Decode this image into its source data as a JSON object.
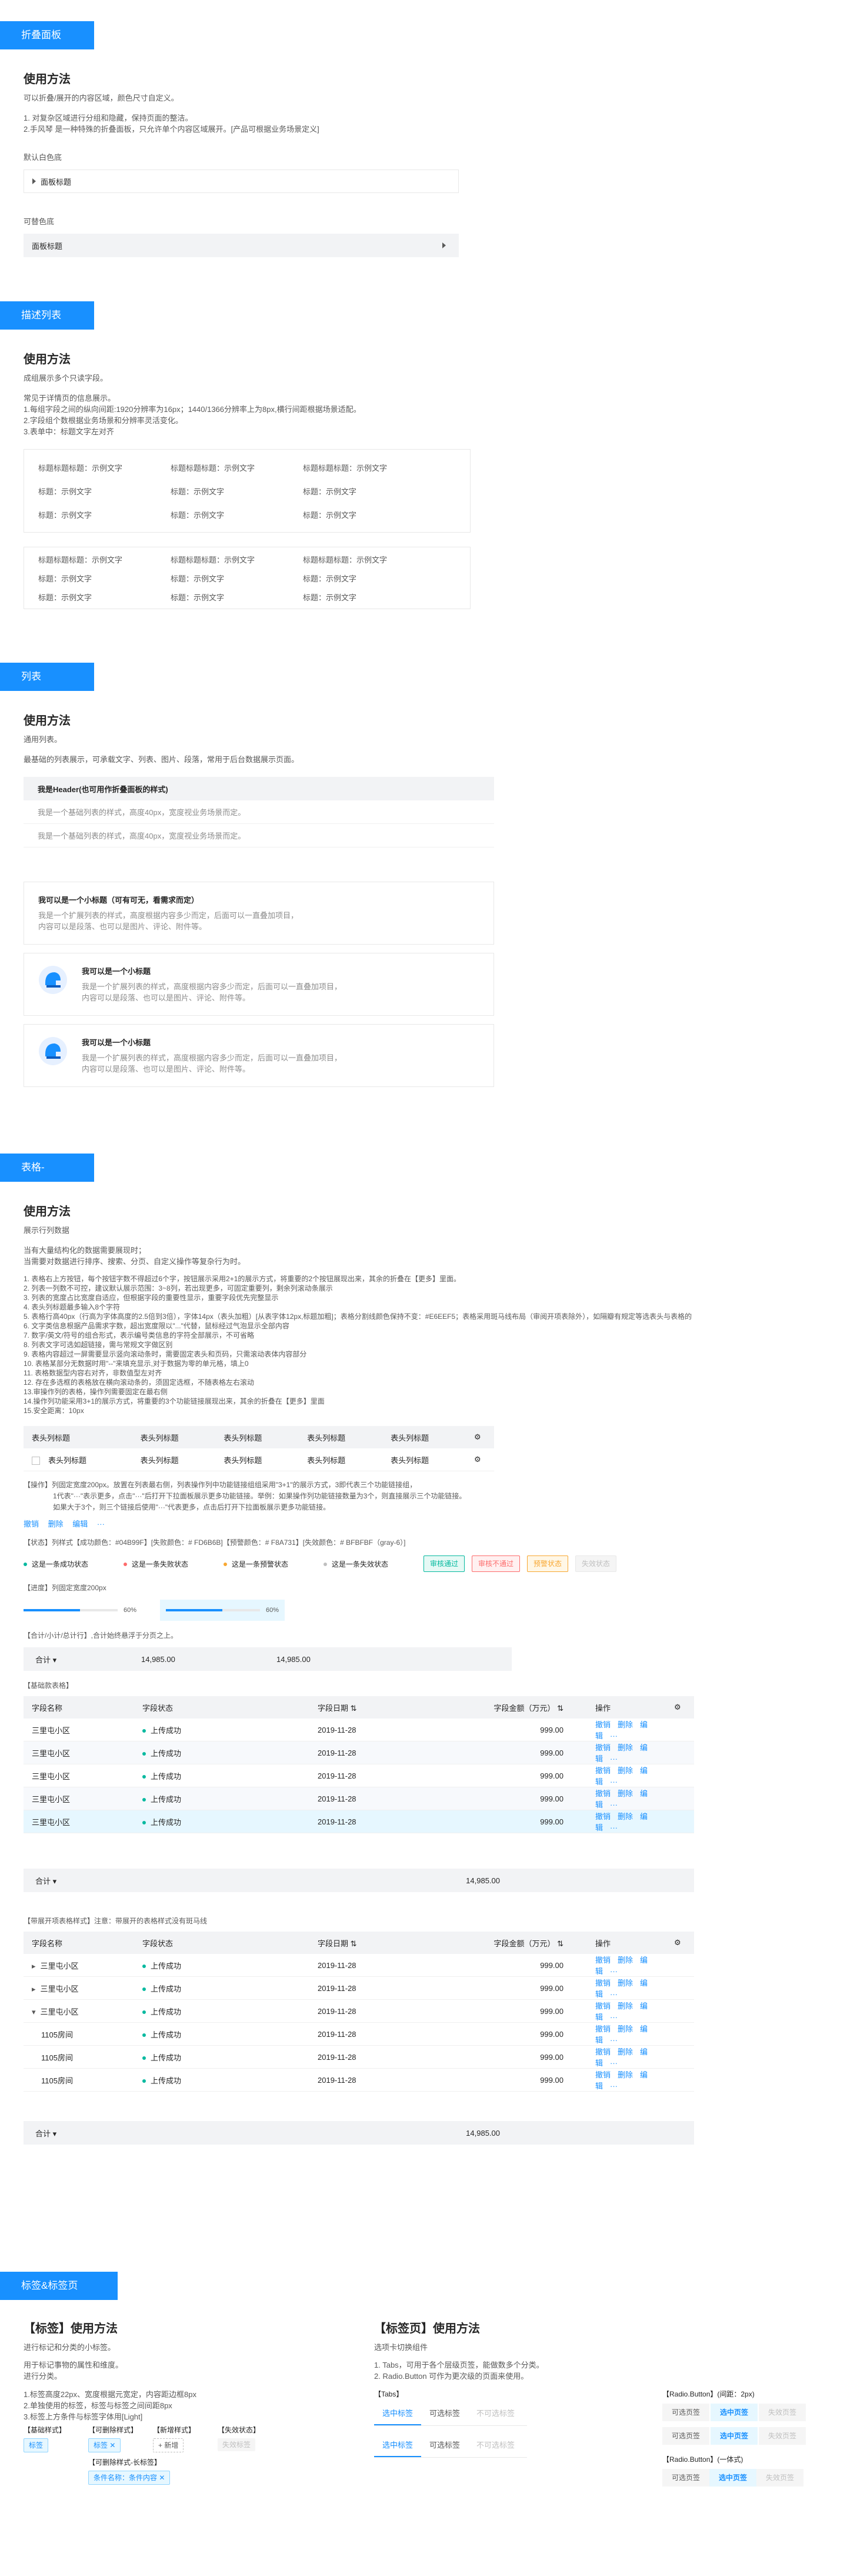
{
  "sections": {
    "collapse": "折叠面板",
    "desc": "描述列表",
    "list": "列表",
    "table": "表格-",
    "tags": "标签&标签页"
  },
  "collapse": {
    "title": "使用方法",
    "subtitle": "可以折叠/展开的内容区域，颜色尺寸自定义。",
    "notes": [
      "1. 对复杂区域进行分组和隐藏，保持页面的整洁。",
      "2.手风琴 是一种特殊的折叠面板，只允许单个内容区域展开。[产品可根据业务场景定义]"
    ],
    "default_label": "默认白色底",
    "default_item": "面板标题",
    "alt_label": "可替色底",
    "alt_item": "面板标题"
  },
  "desc": {
    "title": "使用方法",
    "subtitle": "成组展示多个只读字段。",
    "notes": [
      "常见于详情页的信息展示。",
      "1.每组字段之间的纵向间距:1920分辨率为16px；1440/1366分辨率上为8px,横行间距根据场景适配。",
      "2.字段组个数根据业务场景和分辨率灵活变化。",
      "3.表单中：标题文字左对齐"
    ],
    "box1": [
      [
        "标题标题标题：示例文字",
        "标题标题标题：示例文字",
        "标题标题标题：示例文字"
      ],
      [
        "标题：示例文字",
        "标题：示例文字",
        "标题：示例文字"
      ],
      [
        "标题：示例文字",
        "标题：示例文字",
        "标题：示例文字"
      ]
    ],
    "box2": [
      [
        "标题标题标题：示例文字",
        "标题标题标题：示例文字",
        "标题标题标题：示例文字"
      ],
      [
        "标题：示例文字",
        "标题：示例文字",
        "标题：示例文字"
      ],
      [
        "标题：示例文字",
        "标题：示例文字",
        "标题：示例文字"
      ]
    ]
  },
  "list": {
    "title": "使用方法",
    "subtitle": "通用列表。",
    "desc": "最基础的列表展示，可承载文字、列表、图片、段落，常用于后台数据展示页面。",
    "header": "我是Header(也可用作折叠面板的样式)",
    "items": [
      "我是一个基础列表的样式，高度40px，宽度视业务场景而定。",
      "我是一个基础列表的样式，高度40px，宽度视业务场景而定。"
    ],
    "cards": [
      {
        "title": "我可以是一个小标题（可有可无，看需求而定）",
        "lines": [
          "我是一个扩展列表的样式，高度根据内容多少而定，后面可以一直叠加项目，",
          "内容可以是段落、也可以是图片、评论、附件等。"
        ]
      },
      {
        "title": "我可以是一个小标题",
        "lines": [
          "我是一个扩展列表的样式，高度根据内容多少而定，后面可以一直叠加项目，",
          "内容可以是段落、也可以是图片、评论、附件等。"
        ]
      },
      {
        "title": "我可以是一个小标题",
        "lines": [
          "我是一个扩展列表的样式，高度根据内容多少而定，后面可以一直叠加项目，",
          "内容可以是段落、也可以是图片、评论、附件等。"
        ]
      }
    ]
  },
  "table": {
    "title": "使用方法",
    "subtitle": "展示行列数据",
    "intro": [
      "当有大量结构化的数据需要展现时；",
      "当需要对数据进行排序、搜索、分页、自定义操作等复杂行为时。"
    ],
    "rules": [
      "1. 表格右上方按钮，每个按钮字数不得超过6个字，按钮展示采用2+1的展示方式，将重要的2个按钮展现出来，其余的折叠在【更多】里面。",
      "2. 列表一列数不可控，建议默认展示范围：3~8列，若出现更多，可固定重要列，剩余列滚动条展示",
      "3. 列表的宽度占比宽度自适应，但根据字段的重要性显示，重要字段优先完整显示",
      "4. 表头列标题最多输入8个字符",
      "5. 表格行高40px（行高为字体高度的2.5倍到3倍），字体14px（表头加粗）[从表字体12px,标题加粗]；表格分割线颜色保持不变：#E6EEF5；表格采用斑马线布局（审阅开项表除外），如隔瓣有规定等选表头与表格的",
      "6. 文字类信息根据产品需求字数，超出宽度限以\"...\"代替，鼠标经过气泡显示全部内容",
      "7. 数字/英文/符号的组合形式，表示编号类信息的字符全部展示，不可省略",
      "8. 列表文字可选如超链接，需与常规文字做区别",
      "9. 表格内容超过一屏需要显示竖向滚动条时，需要固定表头和页码，只需滚动表体内容部分",
      "10. 表格某部分无数据时用\"--\"来填充显示,对于数据为零的单元格，填上0",
      "11. 表格数据型内容右对齐，非数值型左对齐",
      "12. 存在多选框的表格放在横向滚动条的，须固定选框，不随表格左右滚动",
      "13.审操作列的表格，操作列需要固定在最右侧",
      "14.操作列功能采用3+1的展示方式，将重要的3个功能链接展现出来，其余的折叠在【更多】里面",
      "15.安全距离：10px"
    ],
    "demo_headers": [
      "表头列标题",
      "表头列标题",
      "表头列标题",
      "表头列标题",
      "表头列标题"
    ],
    "demo_row": [
      "表头列标题",
      "表头列标题",
      "表头列标题",
      "表头列标题",
      "表头列标题"
    ],
    "op_note1": "【操作】列固定宽度200px。放置在列表最右侧，列表操作列中功能链接组组采用\"3+1\"的展示方式，3即代表三个功能链接组，",
    "op_note2": "1代表\"···\"表示更多，点击\"···\"后打开下拉面板展示更多功能链接。举例：如果操作列功能链接数量为3个，则直接展示三个功能链接。",
    "op_note3": "如果大于3个，则三个链接后使用\"···\"代表更多，点击后打开下拉面板展示更多功能链接。",
    "op_links": [
      "撤销",
      "删除",
      "编辑",
      "···"
    ],
    "status_title": "【状态】列样式【成功颜色：#04B99F】[失败颜色：# FD6B6B]【预警颜色：# F8A731】[失效颜色：# BFBFBF（gray-6）]",
    "status_items": [
      "这是一条成功状态",
      "这是一条失败状态",
      "这是一条预警状态",
      "这是一条失效状态"
    ],
    "status_tags": [
      "审核通过",
      "审核不通过",
      "预警状态",
      "失效状态"
    ],
    "progress_title": "【进度】列固定宽度200px",
    "progress": [
      {
        "text": "60%",
        "value": 0.6
      },
      {
        "text": "60%",
        "value": 0.6
      }
    ],
    "total_title": "【合计/小计/总计行】,合计始终悬浮于分页之上。",
    "total_label": "合计",
    "total_vals": [
      "14,985.00",
      "14,985.00"
    ],
    "basic_title": "【基础款表格】",
    "cols": [
      "字段名称",
      "字段状态",
      "字段日期",
      "字段金额（万元）",
      "操作"
    ],
    "basic_rows": [
      [
        "三里屯小区",
        "上传成功",
        "2019-11-28",
        "999.00"
      ],
      [
        "三里屯小区",
        "上传成功",
        "2019-11-28",
        "999.00"
      ],
      [
        "三里屯小区",
        "上传成功",
        "2019-11-28",
        "999.00"
      ],
      [
        "三里屯小区",
        "上传成功",
        "2019-11-28",
        "999.00"
      ],
      [
        "三里屯小区",
        "上传成功",
        "2019-11-28",
        "999.00"
      ]
    ],
    "row_links": [
      "撤销",
      "删除",
      "编辑",
      "···"
    ],
    "basic_total": "14,985.00",
    "expand_title": "【带展开项表格样式】注意：带展开的表格样式没有斑马线",
    "expand_rows": [
      [
        "三里屯小区",
        "上传成功",
        "2019-11-28",
        "999.00"
      ],
      [
        "三里屯小区",
        "上传成功",
        "2019-11-28",
        "999.00"
      ],
      [
        "三里屯小区",
        "上传成功",
        "2019-11-28",
        "999.00"
      ],
      [
        "1105房间",
        "上传成功",
        "2019-11-28",
        "999.00"
      ],
      [
        "1105房间",
        "上传成功",
        "2019-11-28",
        "999.00"
      ],
      [
        "1105房间",
        "上传成功",
        "2019-11-28",
        "999.00"
      ]
    ],
    "expand_total": "14,985.00"
  },
  "tags": {
    "tag_title": "【标签】使用方法",
    "tag_sub": "进行标记和分类的小标签。",
    "tag_notes": [
      "用于标记事物的属性和维度。",
      "进行分类。",
      "",
      "1.标签高度22px、宽度根据元宽定，内容距边框8px",
      "2.单独使用的标签，标签与标签之间间距8px",
      "3.标签上方条件与标签字体用[Light]"
    ],
    "tag_kinds": [
      "【基础样式】",
      "【可删除样式】",
      "【新增样式】",
      "【失效状态】"
    ],
    "tag_basic": "标签",
    "tag_del": "标签",
    "tag_new": "+ 新增",
    "tag_off": "失效标签",
    "tag_long_title": "【可删除样式-长标签】",
    "tag_long": "条件名称：条件内容",
    "tab_title": "【标签页】使用方法",
    "tab_sub": "选项卡切换组件",
    "tab_notes": [
      "1. Tabs，可用于各个层级页签，能做数多个分类。",
      "2. Radio.Button 可作为更次级的页面来使用。"
    ],
    "tabs_label": "【Tabs】",
    "tabs": [
      "选中标签",
      "可选标签",
      "不可选标签"
    ],
    "radio1_label": "【Radio.Button】(间距：2px)",
    "radio2_label": "【Radio.Button】(一体式)",
    "radios": [
      "可选页签",
      "选中页签",
      "失效页签"
    ]
  }
}
